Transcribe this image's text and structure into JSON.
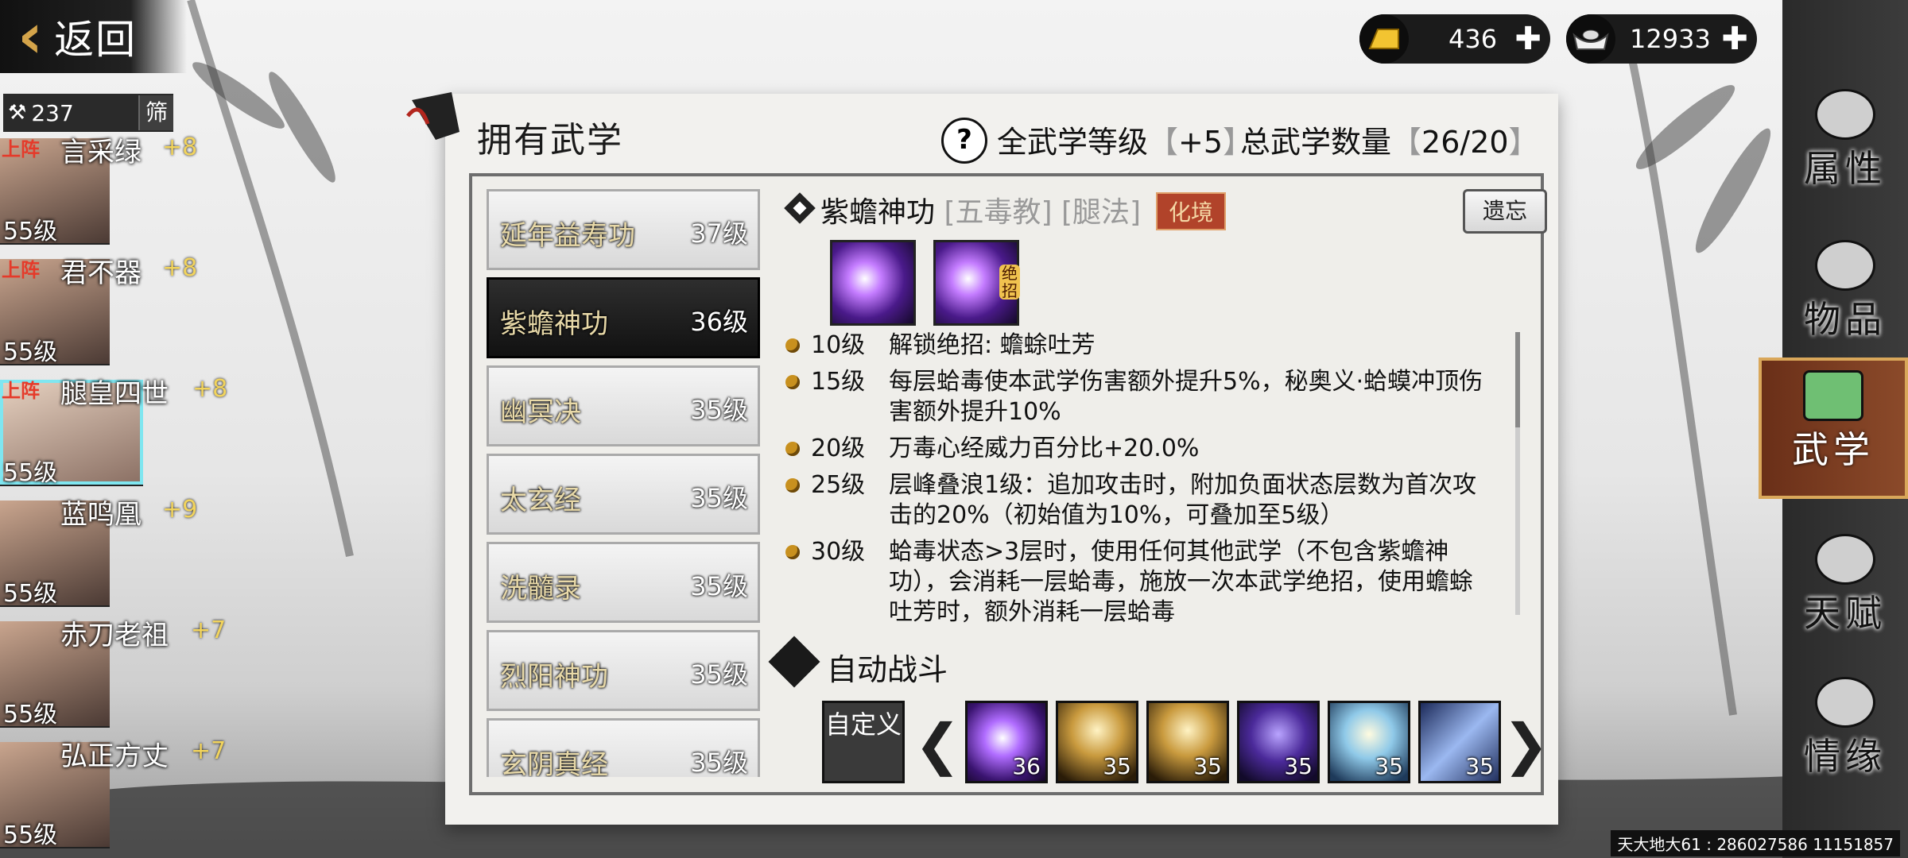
{
  "back": {
    "label": "返回"
  },
  "currency": {
    "gold": "436",
    "silver": "12933"
  },
  "roster": {
    "count": "237",
    "filter_label": "筛",
    "heroes": [
      {
        "tag": "上阵",
        "name": "言采绿",
        "bonus": "+8",
        "level": "55级"
      },
      {
        "tag": "上阵",
        "name": "君不器",
        "bonus": "+8",
        "level": "55级"
      },
      {
        "tag": "上阵",
        "name": "腿皇四世",
        "bonus": "+8",
        "level": "55级"
      },
      {
        "tag": "",
        "name": "蓝鸣凰",
        "bonus": "+9",
        "level": "55级"
      },
      {
        "tag": "",
        "name": "赤刀老祖",
        "bonus": "+7",
        "level": "55级"
      },
      {
        "tag": "",
        "name": "弘正方丈",
        "bonus": "+7",
        "level": "55级"
      }
    ]
  },
  "panel": {
    "title": "拥有武学",
    "all_level_label": "全武学等级",
    "all_level_value": "+5",
    "total_label": "总武学数量",
    "total_value": "26/20"
  },
  "skills": [
    {
      "name": "延年益寿功",
      "level": "37级"
    },
    {
      "name": "紫蟾神功",
      "level": "36级"
    },
    {
      "name": "幽冥决",
      "level": "35级"
    },
    {
      "name": "太玄经",
      "level": "35级"
    },
    {
      "name": "洗髓录",
      "level": "35级"
    },
    {
      "name": "烈阳神功",
      "level": "35级"
    },
    {
      "name": "玄阴真经",
      "level": "35级"
    }
  ],
  "detail": {
    "name": "紫蟾神功",
    "school": "[五毒教]",
    "type": "[腿法]",
    "badge": "化境",
    "forget": "遗忘",
    "ult_tag": "绝招",
    "effects": [
      {
        "level": "10级",
        "text": "解锁绝招:  蟾蜍吐芳"
      },
      {
        "level": "15级",
        "text": "每层蛤毒使本武学伤害额外提升5%，秘奥义·蛤蟆冲顶伤害额外提升10%"
      },
      {
        "level": "20级",
        "text": "万毒心经威力百分比+20.0%"
      },
      {
        "level": "25级",
        "text": "层峰叠浪1级：追加攻击时，附加负面状态层数为首次攻击的20%（初始值为10%，可叠加至5级）"
      },
      {
        "level": "30级",
        "text": "蛤毒状态>3层时，使用任何其他武学（不包含紫蟾神功），会消耗一层蛤毒，施放一次本武学绝招，使用蟾蜍吐芳时，额外消耗一层蛤毒"
      }
    ]
  },
  "auto_battle": {
    "label": "自动战斗",
    "custom": "自定义",
    "slots": [
      "36",
      "35",
      "35",
      "35",
      "35",
      "35"
    ]
  },
  "nav": {
    "items": [
      "属性",
      "物品",
      "武学",
      "天赋",
      "情缘"
    ]
  },
  "footer": "天大地大61 : 286027586  11151857",
  "colors": {
    "accent": "#d4a44a",
    "badge": "#b1432a",
    "selected_nav": "#8b4a2a"
  }
}
